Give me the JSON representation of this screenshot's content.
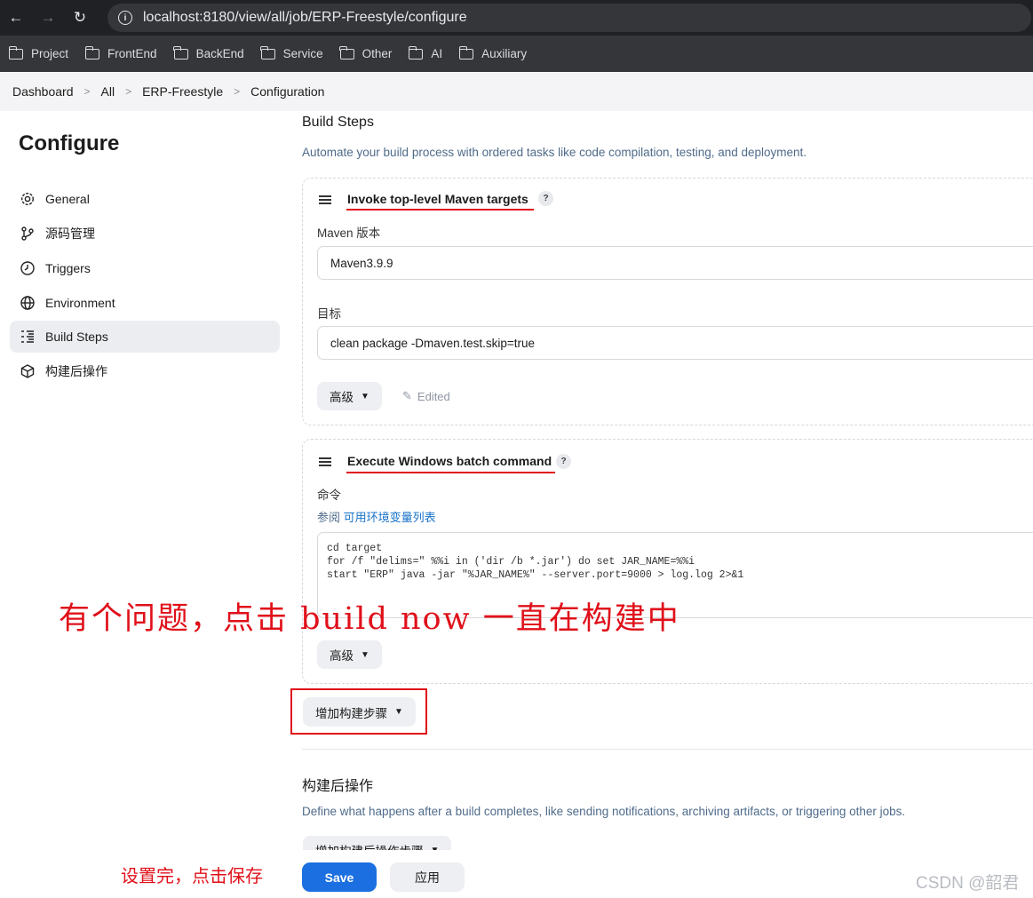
{
  "browser": {
    "url": "localhost:8180/view/all/job/ERP-Freestyle/configure",
    "bookmarks": [
      "Project",
      "FrontEnd",
      "BackEnd",
      "Service",
      "Other",
      "AI",
      "Auxiliary"
    ]
  },
  "breadcrumb": [
    "Dashboard",
    "All",
    "ERP-Freestyle",
    "Configuration"
  ],
  "sidebar": {
    "title": "Configure",
    "items": [
      {
        "label": "General",
        "icon": "gear-icon"
      },
      {
        "label": "源码管理",
        "icon": "branch-icon"
      },
      {
        "label": "Triggers",
        "icon": "clock-icon"
      },
      {
        "label": "Environment",
        "icon": "globe-icon"
      },
      {
        "label": "Build Steps",
        "icon": "list-icon",
        "active": true
      },
      {
        "label": "构建后操作",
        "icon": "cube-icon"
      }
    ]
  },
  "build_steps": {
    "title": "Build Steps",
    "description": "Automate your build process with ordered tasks like code compilation, testing, and deployment.",
    "maven_step": {
      "title": "Invoke top-level Maven targets",
      "help": "?",
      "maven_label": "Maven 版本",
      "maven_value": "Maven3.9.9",
      "goals_label": "目标",
      "goals_value": "clean package -Dmaven.test.skip=true",
      "advanced_label": "高级",
      "edited_label": "Edited"
    },
    "batch_step": {
      "title": "Execute Windows batch command",
      "help": "?",
      "command_label": "命令",
      "see_prefix": "参阅",
      "env_link": "可用环境变量列表",
      "command_text": "cd target\nfor /f \"delims=\" %%i in ('dir /b *.jar') do set JAR_NAME=%%i\nstart \"ERP\" java -jar \"%JAR_NAME%\" --server.port=9000 > log.log 2>&1",
      "advanced_label": "高级"
    },
    "add_step_label": "增加构建步骤"
  },
  "post_build": {
    "title": "构建后操作",
    "description": "Define what happens after a build completes, like sending notifications, archiving artifacts, or triggering other jobs.",
    "add_label": "增加构建后操作步骤"
  },
  "actions": {
    "save": "Save",
    "apply": "应用"
  },
  "annotations": {
    "big": "有个问题，点击 build now 一直在构建中",
    "small": "设置完，点击保存"
  },
  "watermark": "CSDN @韶君",
  "colors": {
    "accent": "#1b6fe0",
    "annotation": "#e0101a"
  }
}
